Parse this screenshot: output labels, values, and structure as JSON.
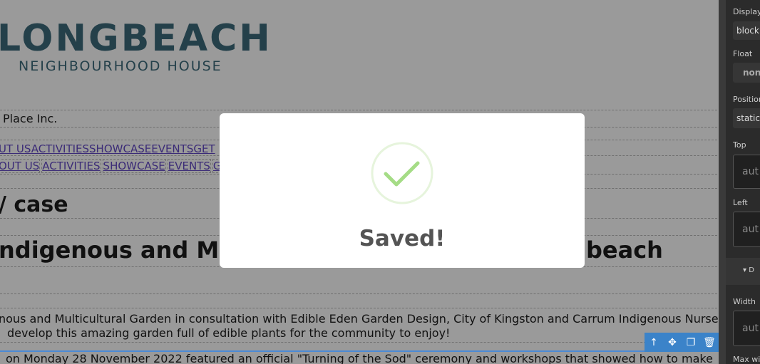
{
  "canvas": {
    "logo": {
      "main": "LONGBEACH",
      "sub": "NEIGHBOURHOOD HOUSE"
    },
    "org_text": "Place Inc.",
    "nav_raw": [
      "UT US",
      "ACTIVITIES",
      "SHOWCASE",
      "EVENTS",
      "GET"
    ],
    "nav_items": [
      "OUT US",
      "ACTIVITIES",
      "SHOWCASE",
      "EVENTS",
      "G"
    ],
    "heading_showcase": "/ case",
    "heading_garden": "ndigenous and Mul",
    "heading_garden_tail": "beach",
    "paragraph_1": "nous and Multicultural Garden in consultation with Edible Eden Garden Design, City of Kingston and Carrum Indigenous Nursery to",
    "paragraph_2": "develop this amazing garden full of edible plants for the community to enjoy!",
    "paragraph_3": "on Monday 28 November 2022 featured an official \"Turning of the Sod\" ceremony and workshops that showed how to make"
  },
  "toolbar": {
    "icons": [
      "arrow-up-icon",
      "move-icon",
      "copy-icon",
      "trash-icon"
    ],
    "glyphs": [
      "↑",
      "✥",
      "❐",
      "🗑"
    ]
  },
  "panel": {
    "display_label": "Display",
    "display_value": "block",
    "float_label": "Float",
    "float_value": "none",
    "position_label": "Position",
    "position_value": "static",
    "top_label": "Top",
    "top_placeholder": "aut",
    "left_label": "Left",
    "left_placeholder": "aut",
    "dimension_toggle": "▾ D",
    "width_label": "Width",
    "width_placeholder": "aut",
    "max_width_label": "Max wi"
  },
  "modal": {
    "message": "Saved!",
    "icon": "success-check-icon",
    "check_color": "#a5dc86"
  }
}
